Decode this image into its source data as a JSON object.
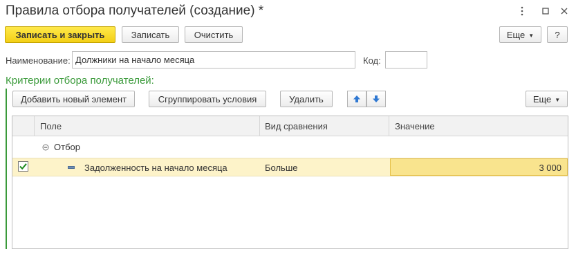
{
  "window": {
    "title": "Правила отбора получателей (создание) *"
  },
  "toolbar": {
    "save_close_label": "Записать и закрыть",
    "save_label": "Записать",
    "clear_label": "Очистить",
    "more_label": "Еще",
    "help_label": "?"
  },
  "form": {
    "name_label": "Наименование:",
    "name_value": "Должники на начало месяца",
    "code_label": "Код:",
    "code_value": ""
  },
  "criteria": {
    "section_title": "Критерии отбора получателей:",
    "add_label": "Добавить новый элемент",
    "group_label": "Сгруппировать условия",
    "delete_label": "Удалить",
    "more_label": "Еще",
    "columns": {
      "field": "Поле",
      "comparison": "Вид сравнения",
      "value": "Значение"
    },
    "root_label": "Отбор",
    "rows": [
      {
        "checked": true,
        "field": "Задолженность на начало месяца",
        "comparison": "Больше",
        "value": "3 000"
      }
    ]
  },
  "colors": {
    "primary_button": "#f5d31f",
    "section_green": "#3a9a3a",
    "selected_row": "#fdf3c9",
    "selected_cell": "#f9e48e",
    "arrow_blue": "#2f78d2"
  }
}
